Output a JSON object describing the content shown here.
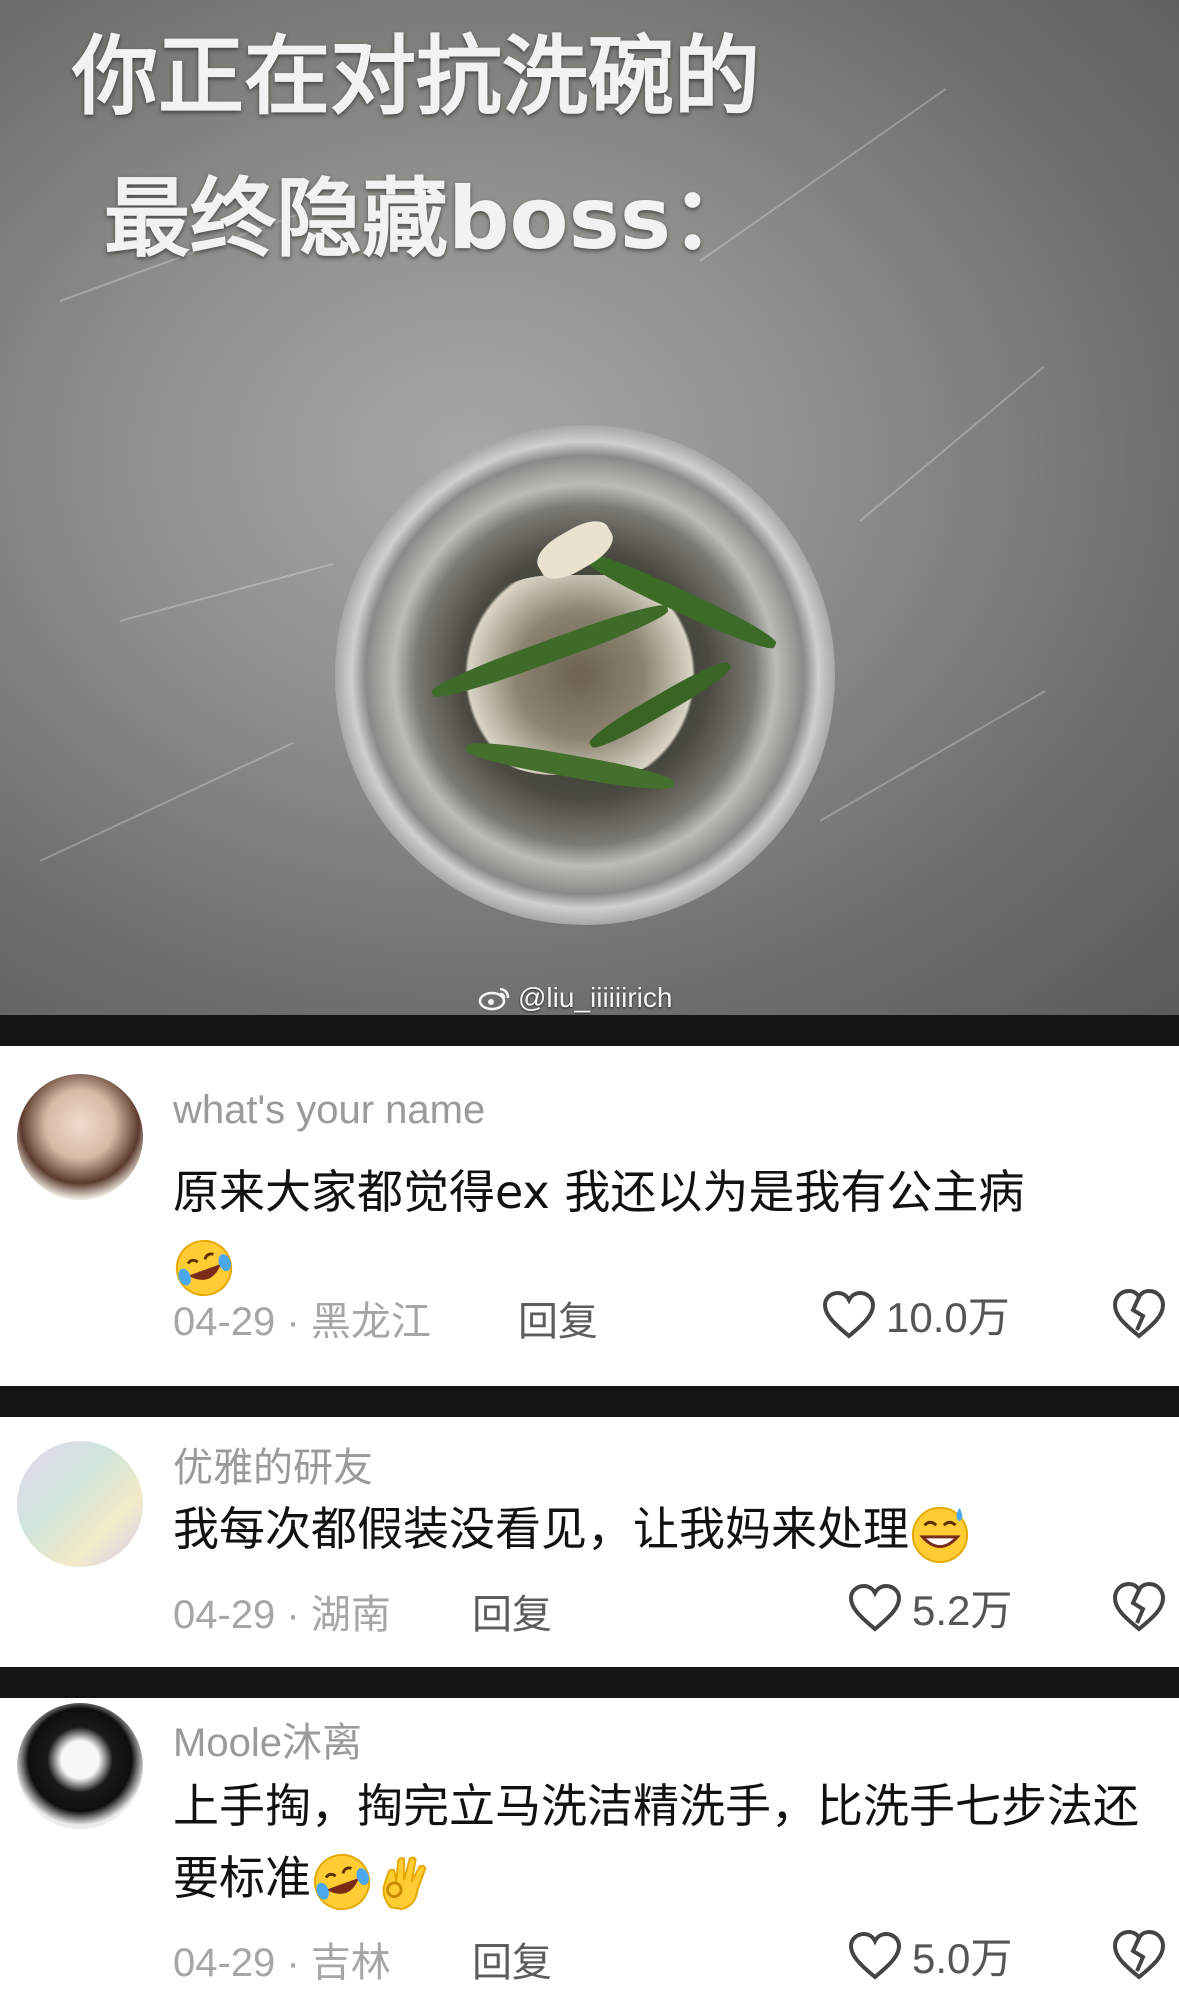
{
  "post": {
    "overlay_line1": "你正在对抗洗碗的",
    "overlay_line2": "最终隐藏boss：",
    "watermark": "@liu_iiiiiirich"
  },
  "comments": [
    {
      "username": "what's your name",
      "text": "原来大家都觉得ex 我还以为是我有公主病",
      "emojis": [
        "rofl-emoji"
      ],
      "date": "04-29 · 黑龙江",
      "reply_label": "回复",
      "likes": "10.0万"
    },
    {
      "username": "优雅的研友",
      "text": "我每次都假装没看见，让我妈来处理",
      "emojis": [
        "grin-sweat-emoji"
      ],
      "date": "04-29 · 湖南",
      "reply_label": "回复",
      "likes": "5.2万"
    },
    {
      "username": "Moole沐离",
      "text": "上手掏，掏完立马洗洁精洗手，比洗手七步法还要标准",
      "emojis": [
        "rofl-emoji",
        "ok-hand-emoji"
      ],
      "date": "04-29 · 吉林",
      "reply_label": "回复",
      "likes": "5.0万"
    }
  ],
  "colors": {
    "separator": "#141414",
    "username": "#9a9a9a",
    "meta": "#a6a6a6"
  }
}
